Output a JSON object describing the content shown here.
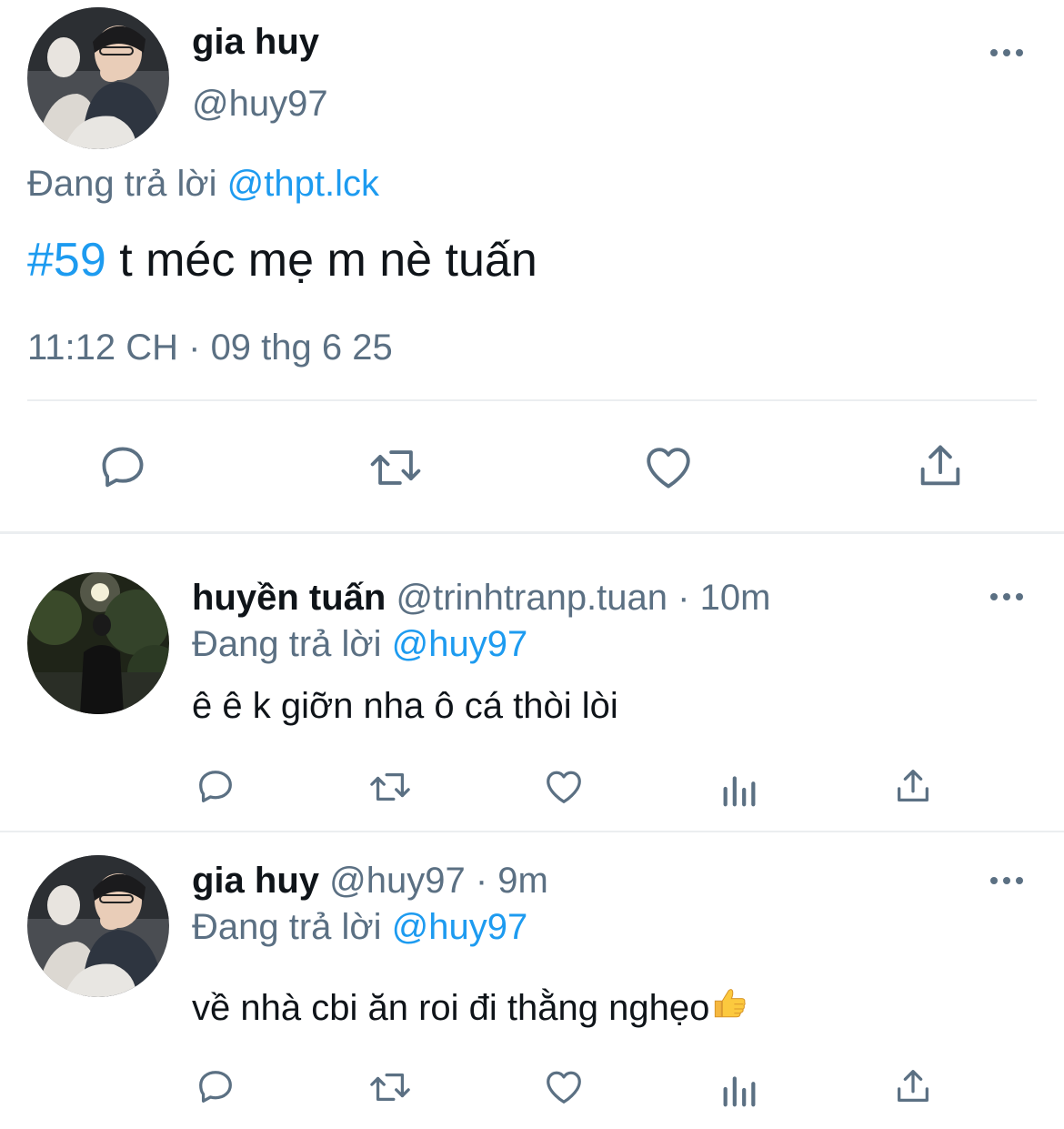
{
  "main_tweet": {
    "name": "gia huy",
    "handle": "@huy97",
    "reply_prefix": "Đang trả lời",
    "reply_to": "@thpt.lck",
    "hashtag": "#59",
    "text": " t méc mẹ m nè tuấn",
    "timestamp": "11:12 CH · 09 thg 6 25"
  },
  "replies": [
    {
      "name": "huyền tuấn",
      "handle": "@trinhtranp.tuan",
      "time": " · 10m",
      "reply_prefix": "Đang trả lời",
      "reply_to": "@huy97",
      "text": "ê ê k giỡn nha ô cá thòi lòi"
    },
    {
      "name": "gia huy",
      "handle": "@huy97",
      "time": " · 9m",
      "reply_prefix": "Đang trả lời",
      "reply_to": "@huy97",
      "text": "về nhà cbi ăn roi đi thằng nghẹo"
    }
  ],
  "icons": {
    "more": "more-horizontal-icon",
    "reply": "reply-icon",
    "retweet": "retweet-icon",
    "like": "heart-icon",
    "views": "analytics-icon",
    "share": "share-icon",
    "emoji": "thumbs-up-emoji"
  },
  "colors": {
    "text": "#0f1419",
    "secondary": "#5b7083",
    "link": "#1d9bf0",
    "divider": "#ebeef0"
  }
}
